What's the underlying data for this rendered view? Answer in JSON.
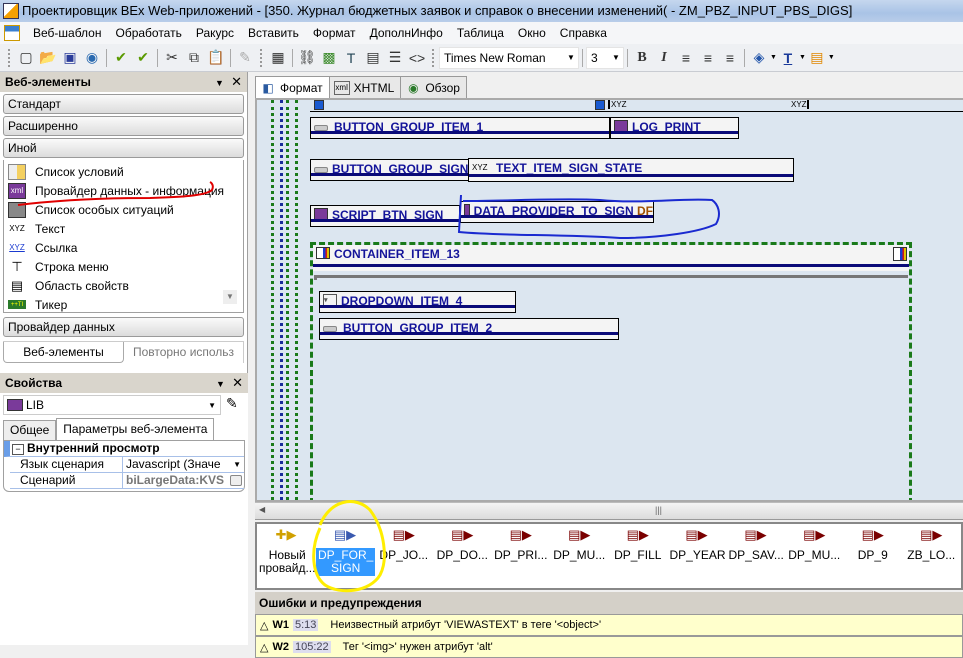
{
  "window": {
    "title": "Проектировщик BEx Web-приложений - [350. Журнал бюджетных заявок и справок о внесении изменений( - ZM_PBZ_INPUT_PBS_DIGS]"
  },
  "menu": [
    "Веб-шаблон",
    "Обработать",
    "Ракурс",
    "Вставить",
    "Формат",
    "ДополнИнфо",
    "Таблица",
    "Окно",
    "Справка"
  ],
  "toolbar": {
    "icons": [
      "new-icon",
      "open-icon",
      "save-icon",
      "publish-icon",
      "check-icon",
      "check-all-icon",
      "cut-icon",
      "copy-icon",
      "paste-icon",
      "validate-icon",
      "table-icon",
      "link-icon",
      "image-icon",
      "text-field-icon",
      "frame-icon",
      "list-icon",
      "code-icon"
    ],
    "font_name": "Times New Roman",
    "font_size": "3",
    "format_icons": [
      "bold-icon",
      "italic-icon",
      "align-left-icon",
      "align-center-icon",
      "align-right-icon",
      "fill-color-icon",
      "font-color-icon",
      "highlight-icon"
    ]
  },
  "web_elements": {
    "header": "Веб-элементы",
    "categories": {
      "standard": "Стандарт",
      "advanced": "Расширенно",
      "other": "Иной",
      "data_provider": "Провайдер данных"
    },
    "items": [
      {
        "label": "Список условий",
        "icon": "condition-list-icon"
      },
      {
        "label": "Провайдер данных - информация",
        "icon": "xml-info-icon"
      },
      {
        "label": "Список особых ситуаций",
        "icon": "exception-list-icon"
      },
      {
        "label": "Текст",
        "icon": "xyz-text-icon"
      },
      {
        "label": "Ссылка",
        "icon": "xyz-link-icon"
      },
      {
        "label": "Строка меню",
        "icon": "menu-bar-icon"
      },
      {
        "label": "Область свойств",
        "icon": "properties-pane-icon"
      },
      {
        "label": "Тикер",
        "icon": "ticker-icon"
      }
    ],
    "bottom_tabs": [
      "Веб-элементы",
      "Повторно использ"
    ]
  },
  "properties": {
    "header": "Свойства",
    "selected_item": "LIB",
    "tabs": [
      "Общее",
      "Параметры веб-элемента"
    ],
    "group": "Внутренний просмотр",
    "rows": [
      {
        "key": "Язык сценария",
        "value": "Javascript (Значе"
      },
      {
        "key": "Сценарий",
        "value": "biLargeData:KVS"
      }
    ]
  },
  "editor": {
    "tabs": [
      "Формат",
      "XHTML",
      "Обзор"
    ],
    "active_tab": "Формат",
    "xyz_labels": [
      "XYZ",
      "XYZ"
    ],
    "items": [
      {
        "id": "BUTTON_GROUP_ITEM_1",
        "icon": "button-group-icon"
      },
      {
        "id": "LOG_PRINT",
        "icon": "script-icon"
      },
      {
        "id": "BUTTON_GROUP_SIGN",
        "icon": "button-group-icon"
      },
      {
        "id": "TEXT_ITEM_SIGN_STATE",
        "icon": "xyz-text-icon",
        "prefix": "XYZ"
      },
      {
        "id": "SCRIPT_BTN_SIGN",
        "icon": "script-icon"
      },
      {
        "id": "DATA_PROVIDER_TO_SIGN",
        "icon": "xml-info-icon",
        "suffix": "DF"
      },
      {
        "id": "CONTAINER_ITEM_13",
        "icon": "container-icon"
      },
      {
        "id": "DROPDOWN_ITEM_4",
        "icon": "dropdown-icon"
      },
      {
        "id": "BUTTON_GROUP_ITEM_2",
        "icon": "button-group-icon"
      }
    ]
  },
  "providers": [
    {
      "label": "Новый провайд...",
      "type": "new"
    },
    {
      "label": "DP_FOR_ SIGN",
      "type": "selected"
    },
    {
      "label": "DP_JO..."
    },
    {
      "label": "DP_DO..."
    },
    {
      "label": "DP_PRI..."
    },
    {
      "label": "DP_MU..."
    },
    {
      "label": "DP_FILL"
    },
    {
      "label": "DP_YEAR"
    },
    {
      "label": "DP_SAV..."
    },
    {
      "label": "DP_MU..."
    },
    {
      "label": "DP_9"
    },
    {
      "label": "ZB_LO..."
    }
  ],
  "warnings": {
    "header": "Ошибки и предупреждения",
    "items": [
      {
        "code": "W1",
        "pos": "5:13",
        "text": "Неизвестный атрибут 'VIEWASTEXT' в теге '<object>'"
      },
      {
        "code": "W2",
        "pos": "105:22",
        "text": "Тег '<img>' нужен атрибут 'alt'"
      }
    ]
  },
  "colors": {
    "selection": "#3399ff",
    "item_text": "#14149a",
    "canvas_bg": "#dce6f0",
    "warning_bg": "#ffffcc"
  }
}
